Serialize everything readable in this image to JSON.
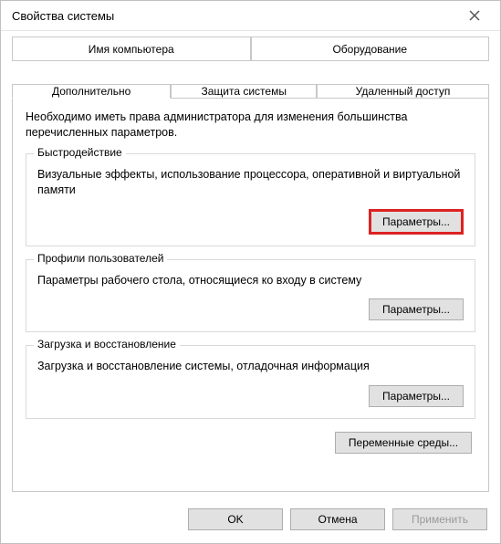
{
  "window": {
    "title": "Свойства системы",
    "close_icon": "close"
  },
  "tabs": {
    "row1": [
      {
        "label": "Имя компьютера"
      },
      {
        "label": "Оборудование"
      }
    ],
    "row2": [
      {
        "label": "Дополнительно",
        "active": true
      },
      {
        "label": "Защита системы"
      },
      {
        "label": "Удаленный доступ"
      }
    ]
  },
  "intro": "Необходимо иметь права администратора для изменения большинства перечисленных параметров.",
  "groups": {
    "performance": {
      "legend": "Быстродействие",
      "desc": "Визуальные эффекты, использование процессора, оперативной и виртуальной памяти",
      "button": "Параметры..."
    },
    "profiles": {
      "legend": "Профили пользователей",
      "desc": "Параметры рабочего стола, относящиеся ко входу в систему",
      "button": "Параметры..."
    },
    "startup": {
      "legend": "Загрузка и восстановление",
      "desc": "Загрузка и восстановление системы, отладочная информация",
      "button": "Параметры..."
    }
  },
  "env_button": "Переменные среды...",
  "footer": {
    "ok": "OK",
    "cancel": "Отмена",
    "apply": "Применить"
  }
}
